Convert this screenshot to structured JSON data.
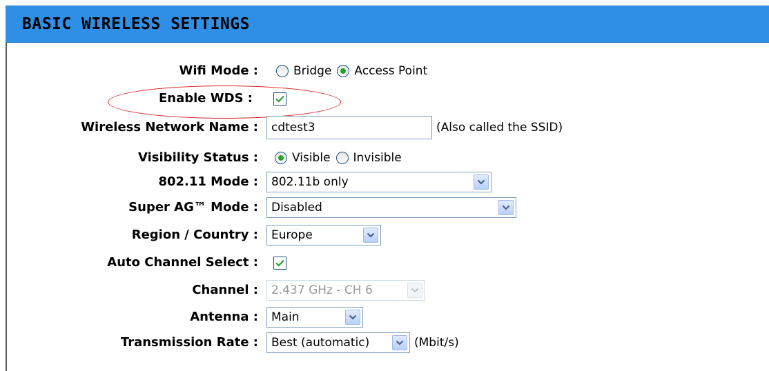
{
  "header": {
    "title": "BASIC WIRELESS SETTINGS"
  },
  "form": {
    "wifi_mode": {
      "label": "Wifi Mode :",
      "options": [
        "Bridge",
        "Access Point"
      ],
      "selected": "Access Point"
    },
    "enable_wds": {
      "label": "Enable WDS :",
      "checked": true
    },
    "network_name": {
      "label": "Wireless Network Name :",
      "value": "cdtest3",
      "note": "(Also called the SSID)"
    },
    "visibility": {
      "label": "Visibility Status :",
      "options": [
        "Visible",
        "Invisible"
      ],
      "selected": "Visible"
    },
    "mode_80211": {
      "label": "802.11 Mode :",
      "value": "802.11b only"
    },
    "super_ag": {
      "label": "Super AG™ Mode :",
      "value": "Disabled"
    },
    "region": {
      "label": "Region / Country :",
      "value": "Europe"
    },
    "auto_channel": {
      "label": "Auto Channel Select :",
      "checked": true
    },
    "channel": {
      "label": "Channel :",
      "value": "2.437 GHz - CH 6",
      "disabled": true
    },
    "antenna": {
      "label": "Antenna :",
      "value": "Main"
    },
    "tx_rate": {
      "label": "Transmission Rate :",
      "value": "Best (automatic)",
      "unit": "(Mbit/s)"
    }
  },
  "colors": {
    "header_bg": "#2f8fe6",
    "highlight_ellipse": "#d62020",
    "radio_dot": "#27a327",
    "check": "#27a327"
  },
  "icons": [
    "radio-unselected-icon",
    "radio-selected-icon",
    "checkbox-checked-icon",
    "chevron-down-icon"
  ]
}
